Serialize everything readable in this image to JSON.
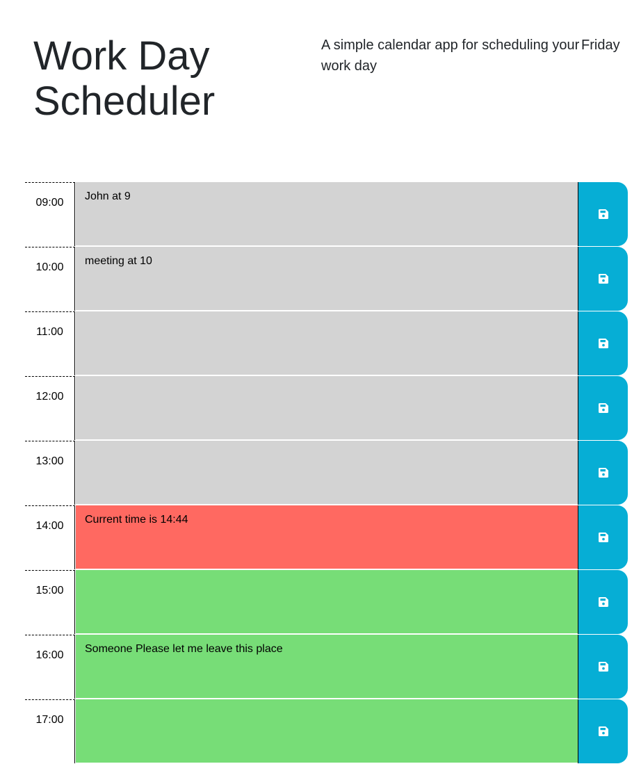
{
  "header": {
    "title": "Work Day Scheduler",
    "lead": "A simple calendar app for scheduling your work day",
    "current_day": "Friday"
  },
  "icons": {
    "save": "floppy-disk-icon"
  },
  "colors": {
    "past": "#d3d3d3",
    "present": "#ff6961",
    "future": "#77dd77",
    "save_button": "#06aed5"
  },
  "rows": [
    {
      "hour": "09:00",
      "text": "John at 9",
      "status": "past"
    },
    {
      "hour": "10:00",
      "text": "meeting at 10",
      "status": "past"
    },
    {
      "hour": "11:00",
      "text": "",
      "status": "past"
    },
    {
      "hour": "12:00",
      "text": "",
      "status": "past"
    },
    {
      "hour": "13:00",
      "text": "",
      "status": "past"
    },
    {
      "hour": "14:00",
      "text": "Current time is 14:44",
      "status": "present"
    },
    {
      "hour": "15:00",
      "text": "",
      "status": "future"
    },
    {
      "hour": "16:00",
      "text": "Someone Please let me leave this place",
      "status": "future"
    },
    {
      "hour": "17:00",
      "text": "",
      "status": "future"
    }
  ]
}
